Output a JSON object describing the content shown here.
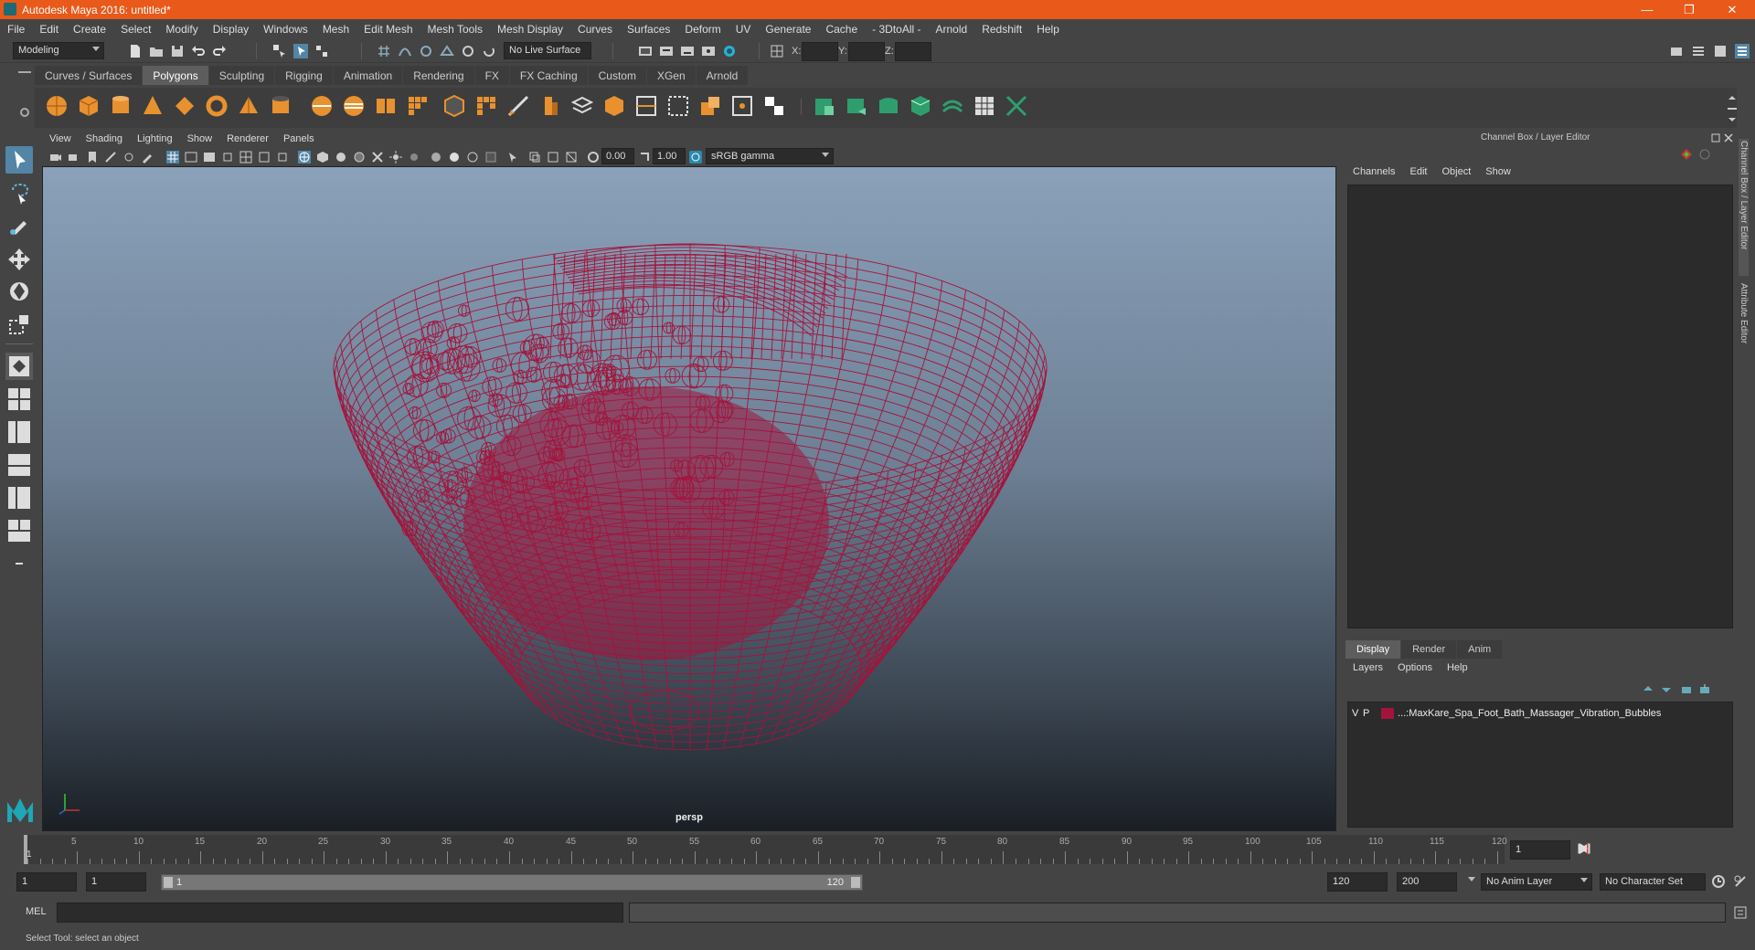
{
  "window": {
    "title": "Autodesk Maya 2016: untitled*",
    "minimize": "—",
    "restore": "❐",
    "close": "✕"
  },
  "menu": [
    "File",
    "Edit",
    "Create",
    "Select",
    "Modify",
    "Display",
    "Windows",
    "Mesh",
    "Edit Mesh",
    "Mesh Tools",
    "Mesh Display",
    "Curves",
    "Surfaces",
    "Deform",
    "UV",
    "Generate",
    "Cache",
    "- 3DtoAll -",
    "Arnold",
    "Redshift",
    "Help"
  ],
  "status": {
    "mode": "Modeling",
    "live_surface": "No Live Surface",
    "x_label": "X:",
    "y_label": "Y:",
    "z_label": "Z:"
  },
  "shelf_tabs": [
    "Curves / Surfaces",
    "Polygons",
    "Sculpting",
    "Rigging",
    "Animation",
    "Rendering",
    "FX",
    "FX Caching",
    "Custom",
    "XGen",
    "Arnold"
  ],
  "shelf_active": "Polygons",
  "viewport": {
    "menu": [
      "View",
      "Shading",
      "Lighting",
      "Show",
      "Renderer",
      "Panels"
    ],
    "exposure": "0.00",
    "gamma": "1.00",
    "color_space": "sRGB gamma",
    "camera": "persp"
  },
  "channel_box": {
    "title": "Channel Box / Layer Editor",
    "menu": [
      "Channels",
      "Edit",
      "Object",
      "Show"
    ]
  },
  "layer_editor": {
    "tabs": [
      "Display",
      "Render",
      "Anim"
    ],
    "active_tab": "Display",
    "menu": [
      "Layers",
      "Options",
      "Help"
    ],
    "layers": [
      {
        "v": "V",
        "p": "P",
        "color": "#a3143c",
        "name": "...:MaxKare_Spa_Foot_Bath_Massager_Vibration_Bubbles"
      }
    ]
  },
  "side_tabs": [
    "Channel Box / Layer Editor",
    "Attribute Editor"
  ],
  "timeline": {
    "start_label": "1",
    "labels": [
      "5",
      "10",
      "15",
      "20",
      "25",
      "30",
      "35",
      "40",
      "45",
      "50",
      "55",
      "60",
      "65",
      "70",
      "75",
      "80",
      "85",
      "90",
      "95",
      "100",
      "105",
      "110",
      "115",
      "120"
    ],
    "current_frame": "1"
  },
  "range": {
    "start": "1",
    "playback_start": "1",
    "slider_start": "1",
    "slider_end": "120",
    "playback_end": "120",
    "end": "200",
    "anim_layer": "No Anim Layer",
    "character_set": "No Character Set"
  },
  "command": {
    "label": "MEL"
  },
  "help_line": "Select Tool: select an object",
  "colors": {
    "titlebar": "#e8591a",
    "wire": "#a3143c",
    "selected_tool": "#5285a6"
  }
}
